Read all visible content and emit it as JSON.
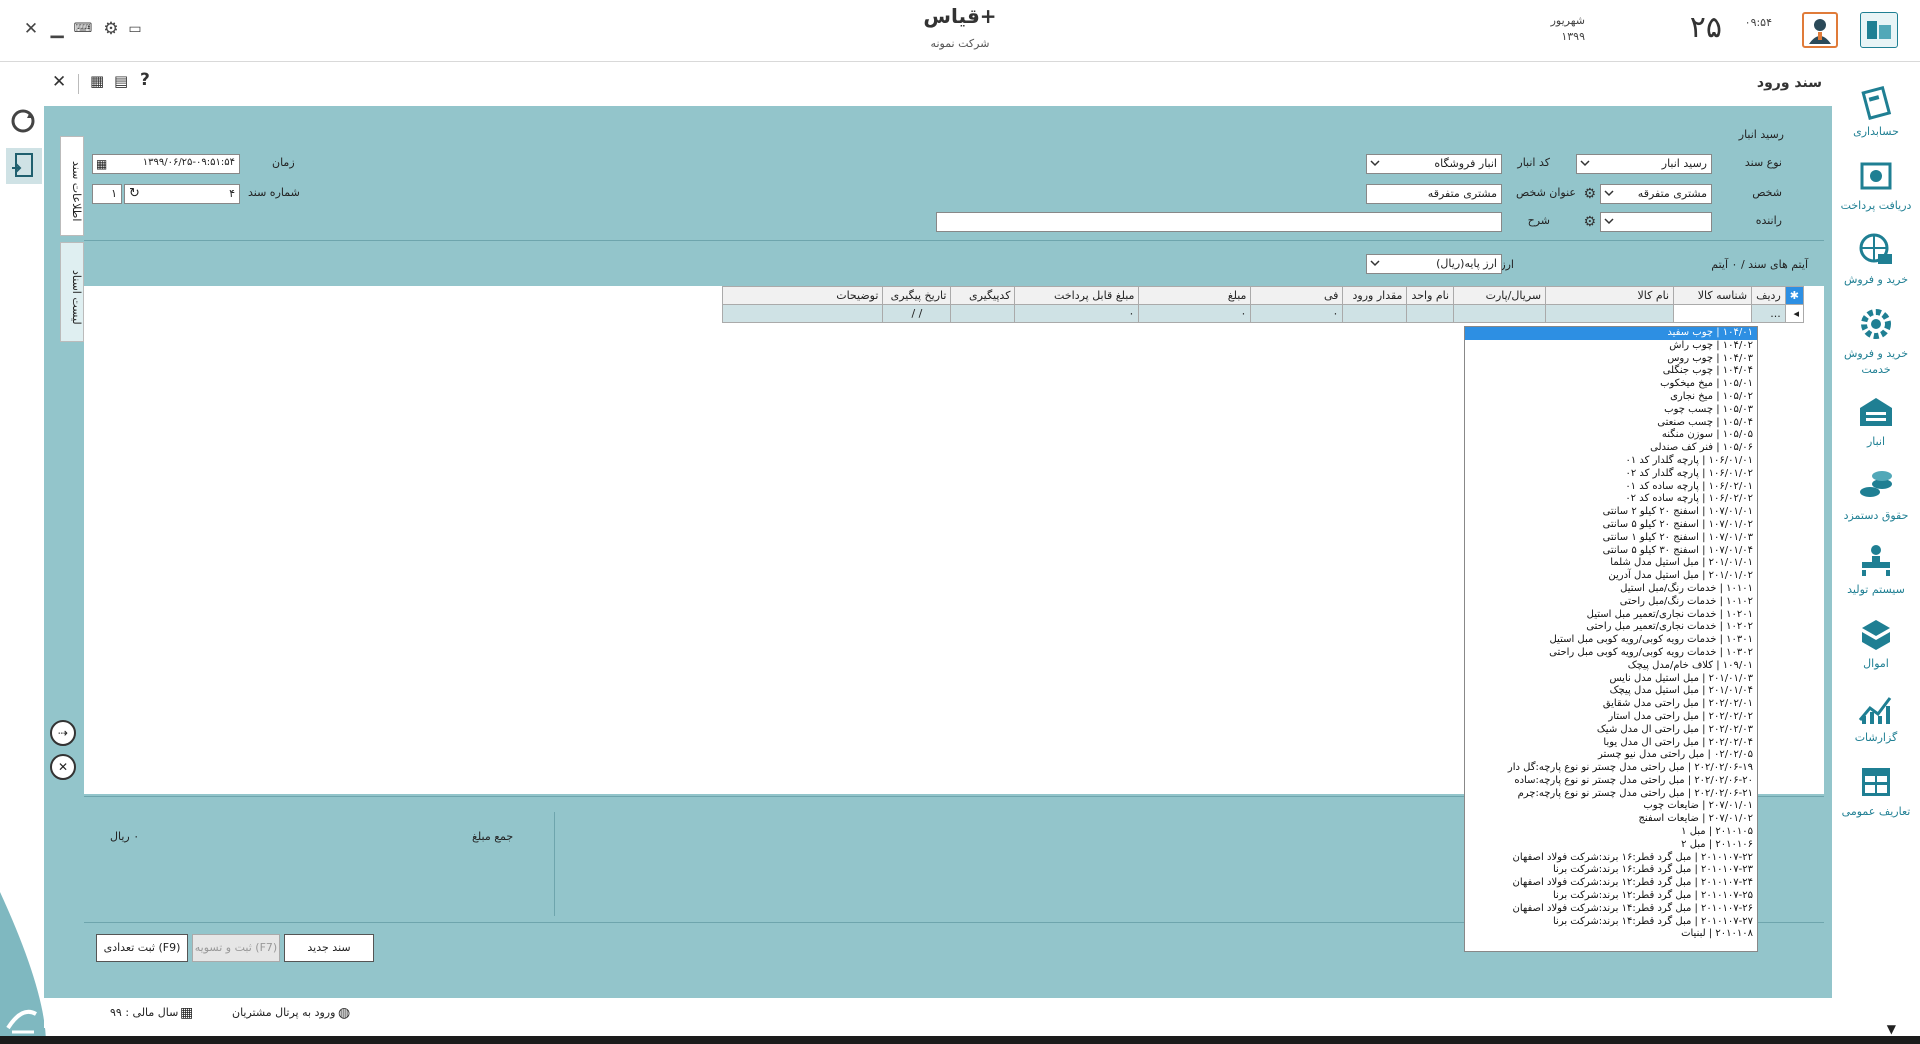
{
  "app": {
    "title": "قیاس+",
    "company": "شرکت نمونه",
    "date_day": "۲۵",
    "date_month": "شهریور",
    "date_year": "۱۳۹۹",
    "time": "۰۹:۵۴"
  },
  "nav": {
    "items": [
      {
        "label": "حسابداری",
        "icon": "accounting-icon"
      },
      {
        "label": "دریافت پرداخت",
        "icon": "payment-icon"
      },
      {
        "label": "خرید و فروش",
        "icon": "globe-cart-icon"
      },
      {
        "label": "خرید و فروش خدمت",
        "icon": "service-gear-icon"
      },
      {
        "label": "انبار",
        "icon": "warehouse-icon"
      },
      {
        "label": "حقوق دستمزد",
        "icon": "coins-icon"
      },
      {
        "label": "سیستم تولید",
        "icon": "production-icon"
      },
      {
        "label": "اموال",
        "icon": "box-icon"
      },
      {
        "label": "گزارشات",
        "icon": "chart-icon"
      },
      {
        "label": "تعاریف عمومی",
        "icon": "table-icon"
      }
    ]
  },
  "form": {
    "title": "سند ورود",
    "section_title": "رسید انبار",
    "tabs": [
      "اطلاعات سند",
      "لیست اسناد"
    ],
    "labels": {
      "doc_type": "نوع سند",
      "warehouse_code": "کد انبار",
      "time": "زمان",
      "person": "شخص",
      "person_title": "عنوان شخص",
      "doc_number": "شماره سند",
      "driver": "راننده",
      "description": "شرح",
      "items_label": "آیتم های سند /",
      "items_count": "۰ آیتم",
      "currency": "ارز"
    },
    "values": {
      "doc_type": "رسید انبار",
      "warehouse": "انبار فروشگاه",
      "datetime": "۱۳۹۹/۰۶/۲۵-۰۹:۵۱:۵۴",
      "person": "مشتری متفرقه",
      "person_title": "مشتری متفرقه",
      "doc_number": "۴",
      "doc_number_suffix": "۱",
      "driver": "",
      "description": "",
      "currency": "ارز پایه(ریال)"
    }
  },
  "grid": {
    "columns": [
      "ردیف",
      "شناسه کالا",
      "نام کالا",
      "سریال/پارت",
      "نام واحد",
      "مقدار ورود",
      "فی",
      "مبلغ",
      "مبلغ قابل پرداخت",
      "کدپیگیری",
      "تاریخ پیگیری",
      "توضیحات"
    ],
    "row": [
      "...",
      "",
      "",
      "",
      "",
      "",
      "۰",
      "۰",
      "۰",
      "",
      "/ /",
      ""
    ]
  },
  "dropdown": {
    "items": [
      "۱۰۴/۰۱ | چوب سفید",
      "۱۰۴/۰۲ | چوب راش",
      "۱۰۴/۰۳ | چوب روس",
      "۱۰۴/۰۴ | چوب جنگلی",
      "۱۰۵/۰۱ | میخ میخکوب",
      "۱۰۵/۰۲ | میخ نجاری",
      "۱۰۵/۰۳ | چسب چوب",
      "۱۰۵/۰۴ | چسب صنعتی",
      "۱۰۵/۰۵ | سوزن منگنه",
      "۱۰۵/۰۶ | فنر کف صندلی",
      "۱۰۶/۰۱/۰۱ | پارچه گلدار کد ۰۱",
      "۱۰۶/۰۱/۰۲ | پارچه گلدار کد ۰۲",
      "۱۰۶/۰۲/۰۱ | پارچه ساده کد ۰۱",
      "۱۰۶/۰۲/۰۲ | پارچه ساده کد ۰۲",
      "۱۰۷/۰۱/۰۱ | اسفنج ۲۰ کیلو ۲ سانتی",
      "۱۰۷/۰۱/۰۲ | اسفنج ۲۰ کیلو ۵ سانتی",
      "۱۰۷/۰۱/۰۳ | اسفنج ۲۰ کیلو ۱ سانتی",
      "۱۰۷/۰۱/۰۴ | اسفنج ۳۰ کیلو ۵ سانتی",
      "۲۰۱/۰۱/۰۱ | مبل استیل مدل شلما",
      "۲۰۱/۰۱/۰۲ | مبل استیل مدل آدرین",
      "۱۰۱۰۱ | خدمات رنگ/مبل استیل",
      "۱۰۱۰۲ | خدمات رنگ/مبل راحتی",
      "۱۰۲۰۱ | خدمات نجاری/تعمیر مبل استیل",
      "۱۰۲۰۲ | خدمات نجاری/تعمیر مبل راحتی",
      "۱۰۳۰۱ | خدمات رویه کوبی/رویه کوبی مبل استیل",
      "۱۰۳۰۲ | خدمات رویه کوبی/رویه کوبی مبل راحتی",
      "۱۰۹/۰۱ | کلاف خام/مدل پیچک",
      "۲۰۱/۰۱/۰۳ | مبل استیل مدل نایس",
      "۲۰۱/۰۱/۰۴ | مبل استیل مدل پیچک",
      "۲۰۲/۰۲/۰۱ | مبل راحتی مدل شقایق",
      "۲۰۲/۰۲/۰۲ | مبل راحتی مدل استار",
      "۲۰۲/۰۲/۰۳ | مبل راحتی ال مدل شیک",
      "۲۰۲/۰۲/۰۴ | مبل راحتی ال مدل یوبا",
      "۰۲/۰۲/۰۵ | مبل راحتی مدل نیو چستر",
      "۲۰۲/۰۲/۰۶-۱۹ | مبل راحتی مدل چستر نو نوع پارچه:گل دار",
      "۲۰۲/۰۲/۰۶-۲۰ | مبل راحتی مدل چستر نو نوع پارچه:ساده",
      "۲۰۲/۰۲/۰۶-۲۱ | مبل راحتی مدل چستر نو نوع پارچه:چرم",
      "۲۰۷/۰۱/۰۱ | ضایعات چوب",
      "۲۰۷/۰۱/۰۲ | ضایعات اسفنج",
      "۲۰۱۰۱۰۵ | مبل ۱",
      "۲۰۱۰۱۰۶ | مبل ۲",
      "۲۰۱۰۱۰۷-۲۲ | مبل گرد قطر:۱۶ برند:شرکت فولاد اصفهان",
      "۲۰۱۰۱۰۷-۲۳ | مبل گرد قطر:۱۶ برند:شرکت برنا",
      "۲۰۱۰۱۰۷-۲۴ | مبل گرد قطر:۱۲ برند:شرکت فولاد اصفهان",
      "۲۰۱۰۱۰۷-۲۵ | مبل گرد قطر:۱۲ برند:شرکت برنا",
      "۲۰۱۰۱۰۷-۲۶ | مبل گرد قطر:۱۴ برند:شرکت فولاد اصفهان",
      "۲۰۱۰۱۰۷-۲۷ | مبل گرد قطر:۱۴ برند:شرکت برنا",
      "۲۰۱۰۱۰۸ | لبنیات"
    ]
  },
  "footer": {
    "sum_label": "جمع مبلغ",
    "sum_value": "۰ ریال",
    "btn_new": "سند جدید",
    "btn_save_settle": "ثبت و تسویه (F7)",
    "btn_save_count": "ثبت تعدادی (F9)",
    "fiscal_year": "سال مالی : ۹۹",
    "portal": "ورود به پرتال مشتریان"
  },
  "colors": {
    "teal": "#93c5cb",
    "accent": "#1f7f93",
    "selected": "#2d8fe3"
  }
}
